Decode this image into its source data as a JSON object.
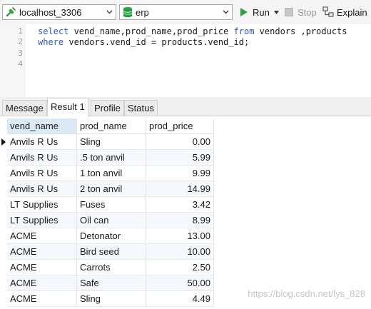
{
  "toolbar": {
    "connection": "localhost_3306",
    "database": "erp",
    "run_label": "Run",
    "stop_label": "Stop",
    "explain_label": "Explain"
  },
  "editor": {
    "lines": [
      {
        "num": "1",
        "tokens": [
          [
            "kw",
            "select"
          ],
          [
            "tx",
            " vend_name,prod_name,prod_price "
          ],
          [
            "kw",
            "from"
          ],
          [
            "tx",
            " vendors ,products"
          ]
        ]
      },
      {
        "num": "2",
        "tokens": [
          [
            "kw",
            "where"
          ],
          [
            "tx",
            " vendors.vend_id = products.vend_id;"
          ]
        ]
      },
      {
        "num": "3",
        "tokens": []
      },
      {
        "num": "4",
        "tokens": []
      }
    ]
  },
  "tabs": [
    "Message",
    "Result 1",
    "Profile",
    "Status"
  ],
  "active_tab": "Result 1",
  "result": {
    "columns": [
      "vend_name",
      "prod_name",
      "prod_price"
    ],
    "rows": [
      [
        "Anvils R Us",
        "Sling",
        "0.00"
      ],
      [
        "Anvils R Us",
        ".5 ton anvil",
        "5.99"
      ],
      [
        "Anvils R Us",
        "1 ton anvil",
        "9.99"
      ],
      [
        "Anvils R Us",
        "2 ton anvil",
        "14.99"
      ],
      [
        "LT Supplies",
        "Fuses",
        "3.42"
      ],
      [
        "LT Supplies",
        "Oil can",
        "8.99"
      ],
      [
        "ACME",
        "Detonator",
        "13.00"
      ],
      [
        "ACME",
        "Bird seed",
        "10.00"
      ],
      [
        "ACME",
        "Carrots",
        "2.50"
      ],
      [
        "ACME",
        "Safe",
        "50.00"
      ],
      [
        "ACME",
        "Sling",
        "4.49"
      ]
    ],
    "current_row": 0
  },
  "watermark": "https://blog.csdn.net/lys_828",
  "colors": {
    "keyword": "#2b57d6",
    "run_green": "#2ea043",
    "db_green": "#1f9d3a",
    "header_selected": "#dce9f7"
  }
}
